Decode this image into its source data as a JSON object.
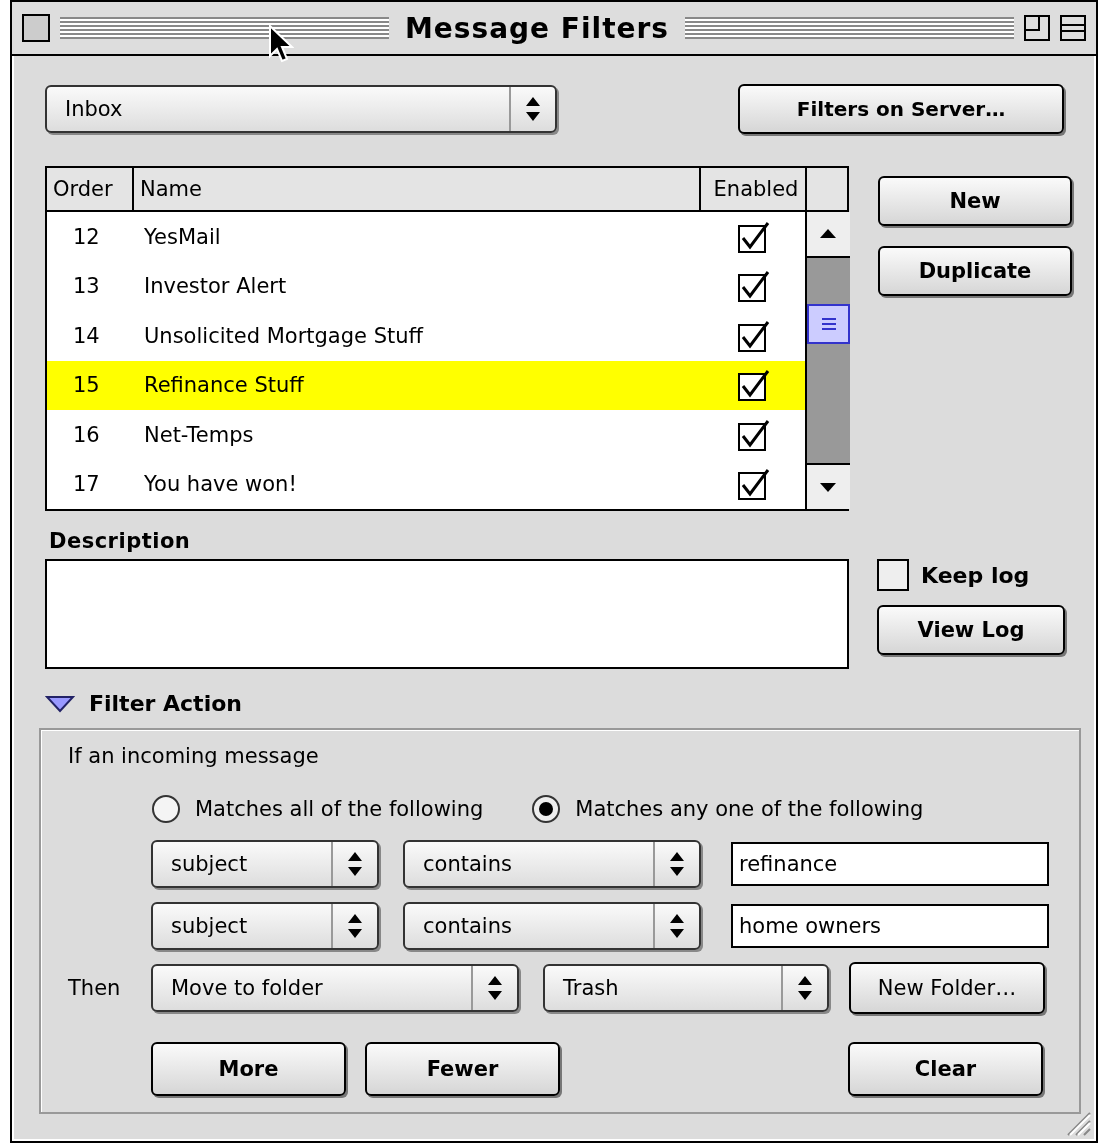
{
  "window": {
    "title": "Message Filters"
  },
  "mailbox": {
    "value": "Inbox"
  },
  "server_button": "Filters on Server…",
  "table": {
    "columns": [
      "Order",
      "Name",
      "Enabled"
    ],
    "rows": [
      {
        "order": "12",
        "name": "YesMail",
        "enabled": true,
        "selected": false
      },
      {
        "order": "13",
        "name": "Investor Alert",
        "enabled": true,
        "selected": false
      },
      {
        "order": "14",
        "name": "Unsolicited Mortgage Stuff",
        "enabled": true,
        "selected": false
      },
      {
        "order": "15",
        "name": "Refinance Stuff",
        "enabled": true,
        "selected": true
      },
      {
        "order": "16",
        "name": "Net-Temps",
        "enabled": true,
        "selected": false
      },
      {
        "order": "17",
        "name": "You have won!",
        "enabled": true,
        "selected": false
      }
    ]
  },
  "side_buttons": [
    "New",
    "Duplicate"
  ],
  "description": {
    "label": "Description"
  },
  "keep_log": {
    "label": "Keep log",
    "checked": false
  },
  "view_log_button": "View Log",
  "filter_action": {
    "label": "Filter Action",
    "expanded": true,
    "intro": "If an incoming message",
    "match_options": [
      {
        "label": "Matches all of the following",
        "selected": false
      },
      {
        "label": "Matches any one of the following",
        "selected": true
      }
    ],
    "conditions": [
      {
        "field": "subject",
        "operator": "contains",
        "value": "refinance"
      },
      {
        "field": "subject",
        "operator": "contains",
        "value": "home owners"
      }
    ],
    "then_label": "Then",
    "action": "Move to folder",
    "target": "Trash",
    "new_folder_button": "New Folder…",
    "buttons": [
      "More",
      "Fewer",
      "Clear"
    ]
  }
}
